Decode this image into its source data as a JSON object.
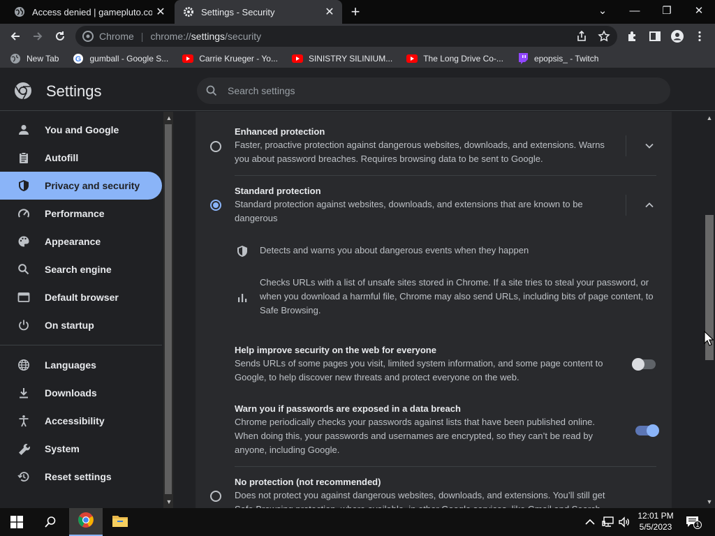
{
  "browser": {
    "tabs": [
      {
        "title": "Access denied | gamepluto.com",
        "active": false,
        "icon": "globe-icon"
      },
      {
        "title": "Settings - Security",
        "active": true,
        "icon": "gear-icon"
      }
    ],
    "new_tab_label": "+",
    "window_controls": {
      "dropdown": "⌄",
      "minimize": "—",
      "restore": "❐",
      "close": "✕"
    },
    "omnibox": {
      "site_label": "Chrome",
      "url_scheme": "chrome://",
      "url_host": "settings",
      "url_path": "/security"
    },
    "bookmarks": [
      {
        "label": "New Tab",
        "icon": "globe-icon"
      },
      {
        "label": "gumball - Google S...",
        "icon": "google-icon"
      },
      {
        "label": "Carrie Krueger - Yo...",
        "icon": "youtube-icon"
      },
      {
        "label": "SINISTRY SILINIUM...",
        "icon": "youtube-icon"
      },
      {
        "label": "The Long Drive Co-...",
        "icon": "youtube-icon"
      },
      {
        "label": "epopsis_ - Twitch",
        "icon": "twitch-icon"
      }
    ]
  },
  "settings": {
    "title": "Settings",
    "search_placeholder": "Search settings",
    "nav": [
      {
        "label": "You and Google",
        "icon": "person-icon",
        "active": false
      },
      {
        "label": "Autofill",
        "icon": "clipboard-icon",
        "active": false
      },
      {
        "label": "Privacy and security",
        "icon": "shield-icon",
        "active": true
      },
      {
        "label": "Performance",
        "icon": "speedometer-icon",
        "active": false
      },
      {
        "label": "Appearance",
        "icon": "palette-icon",
        "active": false
      },
      {
        "label": "Search engine",
        "icon": "search-icon",
        "active": false
      },
      {
        "label": "Default browser",
        "icon": "browser-icon",
        "active": false
      },
      {
        "label": "On startup",
        "icon": "power-icon",
        "active": false
      },
      {
        "label": "Languages",
        "icon": "globe-icon",
        "active": false
      },
      {
        "label": "Downloads",
        "icon": "download-icon",
        "active": false
      },
      {
        "label": "Accessibility",
        "icon": "accessibility-icon",
        "active": false
      },
      {
        "label": "System",
        "icon": "wrench-icon",
        "active": false
      },
      {
        "label": "Reset settings",
        "icon": "history-icon",
        "active": false
      }
    ],
    "enhanced": {
      "title": "Enhanced protection",
      "desc": "Faster, proactive protection against dangerous websites, downloads, and extensions. Warns you about password breaches. Requires browsing data to be sent to Google.",
      "selected": false
    },
    "standard": {
      "title": "Standard protection",
      "desc": "Standard protection against websites, downloads, and extensions that are known to be dangerous",
      "selected": true,
      "detail1": "Detects and warns you about dangerous events when they happen",
      "detail2": "Checks URLs with a list of unsafe sites stored in Chrome. If a site tries to steal your password, or when you download a harmful file, Chrome may also send URLs, including bits of page content, to Safe Browsing."
    },
    "help_improve": {
      "title": "Help improve security on the web for everyone",
      "desc": "Sends URLs of some pages you visit, limited system information, and some page content to Google, to help discover new threats and protect everyone on the web.",
      "enabled": false
    },
    "password_breach": {
      "title": "Warn you if passwords are exposed in a data breach",
      "desc": "Chrome periodically checks your passwords against lists that have been published online. When doing this, your passwords and usernames are encrypted, so they can’t be read by anyone, including Google.",
      "enabled": true
    },
    "no_protection": {
      "title": "No protection (not recommended)",
      "desc": "Does not protect you against dangerous websites, downloads, and extensions. You’ll still get Safe Browsing protection, where available, in other Google services, like Gmail and Search.",
      "selected": false
    }
  },
  "taskbar": {
    "time": "12:01 PM",
    "date": "5/5/2023",
    "notification_count": "1"
  },
  "colors": {
    "accent": "#8ab4f8",
    "surface": "#292a2d",
    "background": "#202124"
  }
}
